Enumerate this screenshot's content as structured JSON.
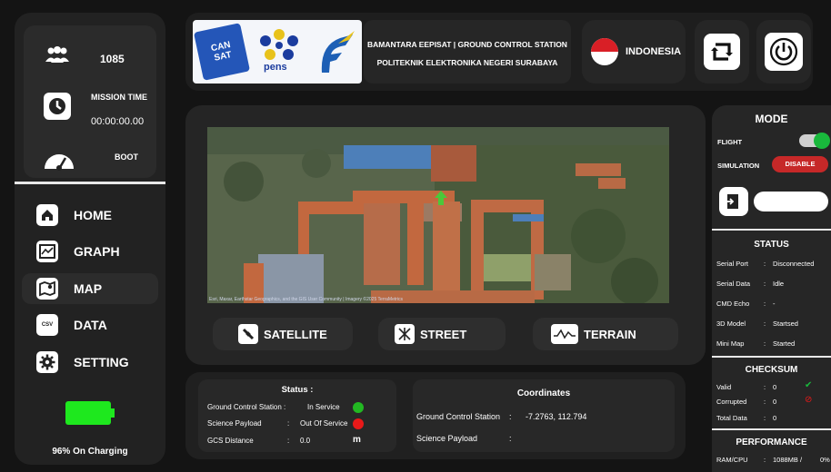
{
  "sidebar": {
    "packet_count": "1085",
    "mission_time_label": "MISSION TIME",
    "mission_time": "00:00:00.00",
    "state": "BOOT",
    "nav": [
      {
        "label": "HOME",
        "icon": "home-icon"
      },
      {
        "label": "GRAPH",
        "icon": "graph-icon"
      },
      {
        "label": "MAP",
        "icon": "map-icon",
        "active": true
      },
      {
        "label": "DATA",
        "icon": "csv-icon"
      },
      {
        "label": "SETTING",
        "icon": "gear-icon"
      }
    ],
    "battery_text": "96% On Charging"
  },
  "header": {
    "title_line1": "BAMANTARA EEPISAT | GROUND CONTROL STATION",
    "title_line2": "POLITEKNIK ELEKTRONIKA NEGERI SURABAYA",
    "country": "INDONESIA",
    "logos": {
      "cansat": "CAN SAT",
      "pens": "pens"
    }
  },
  "map": {
    "attribution": "Esri, Maxar, Earthstar Geographics, and the GIS User Community | Imagery ©2025 TerraMetrics",
    "buttons": [
      {
        "label": "SATELLITE",
        "icon": "satellite-icon"
      },
      {
        "label": "STREET",
        "icon": "street-icon"
      },
      {
        "label": "TERRAIN",
        "icon": "terrain-icon"
      }
    ]
  },
  "status": {
    "title": "Status :",
    "rows": [
      {
        "label": "Ground Control Station :",
        "value": "In Service",
        "color": "#22b822"
      },
      {
        "label": "Science Payload",
        "sep": ":",
        "value": "Out Of Service",
        "color": "#e81919"
      },
      {
        "label": "GCS Distance",
        "sep": ":",
        "value": "0.0",
        "unit": "m"
      }
    ]
  },
  "coordinates": {
    "title": "Coordinates",
    "gcs_label": "Ground Control Station",
    "gcs_value": "-7.2763, 112.794",
    "payload_label": "Science Payload",
    "sep": ":"
  },
  "mode": {
    "title": "MODE",
    "flight_label": "FLIGHT",
    "flight_on": true,
    "simulation_label": "SIMULATION",
    "simulation_button": "DISABLE"
  },
  "status_panel": {
    "title": "STATUS",
    "rows": [
      {
        "k": "Serial Port",
        "v": "Disconnected"
      },
      {
        "k": "Serial Data",
        "v": "Idle"
      },
      {
        "k": "CMD Echo",
        "v": "-"
      },
      {
        "k": "3D Model",
        "v": "Startsed"
      },
      {
        "k": "Mini Map",
        "v": "Started"
      }
    ]
  },
  "checksum": {
    "title": "CHECKSUM",
    "rows": [
      {
        "k": "Valid",
        "v": "0"
      },
      {
        "k": "Corrupted",
        "v": "0"
      },
      {
        "k": "Total Data",
        "v": "0"
      }
    ]
  },
  "performance": {
    "title": "PERFORMANCE",
    "label": "RAM/CPU",
    "ram": "1088MB /",
    "cpu": "0%"
  },
  "colors": {
    "accent_green": "#1ee81e",
    "alert_red": "#e81919",
    "disable_red": "#c62828"
  }
}
